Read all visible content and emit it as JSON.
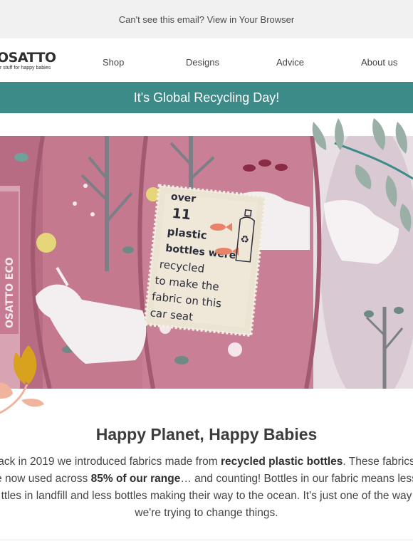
{
  "preheader": {
    "text": "Can't see this email? View in Your Browser"
  },
  "brand": {
    "logo_text": "OSATTO",
    "tagline": "r stuff for happy babies"
  },
  "nav": {
    "items": [
      "Shop",
      "Designs",
      "Advice",
      "About us"
    ]
  },
  "banner": {
    "text": "It's Global Recycling Day!"
  },
  "hero": {
    "label_lines": [
      "over",
      "11",
      "plastic",
      "bottles were",
      "recycled",
      "to make the",
      "fabric on this",
      "car seat"
    ],
    "product_tag": "OSATTO ECO"
  },
  "article": {
    "heading": "Happy Planet, Happy Babies",
    "p1": "ack in 2019 we introduced fabrics made from ",
    "p1_bold": "recycled plastic bottles",
    "p2": ". These fabrics",
    "p3": "e now used across ",
    "p3_bold": "85% of our range",
    "p4": "… and counting! Bottles in our fabric means less",
    "p5": "ttles in landfill and less bottles making their way to the ocean. It's just one of the way",
    "p6": "we're trying to change things."
  },
  "colors": {
    "banner": "#3c8b88",
    "fabric": "#c4798f",
    "preheader_bg": "#f1f1f1"
  }
}
